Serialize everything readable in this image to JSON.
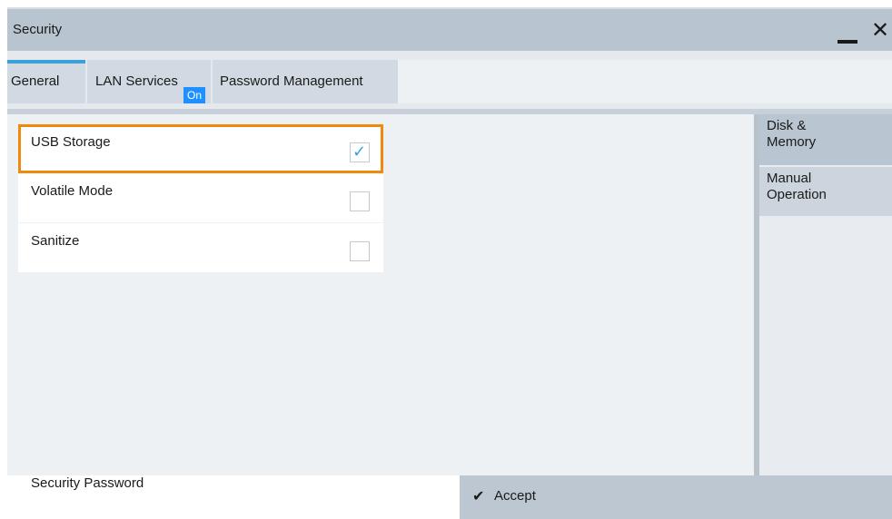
{
  "window": {
    "title": "Security"
  },
  "tabs": [
    {
      "label": "General",
      "active": true
    },
    {
      "label": "LAN Services",
      "badge": "On"
    },
    {
      "label": "Password Management"
    }
  ],
  "settings": [
    {
      "label": "USB Storage",
      "checked": true
    },
    {
      "label": "Volatile Mode",
      "checked": false
    },
    {
      "label": "Sanitize",
      "checked": false
    }
  ],
  "side_panel": {
    "items": [
      {
        "label_line1": "Disk &",
        "label_line2": "Memory"
      },
      {
        "label_line1": "Manual",
        "label_line2": "Operation"
      }
    ]
  },
  "bottom": {
    "password_label": "Security Password",
    "accept_label": "Accept"
  },
  "icons": {
    "minimize": "minimize-icon",
    "close": "close-icon",
    "checkmark": "checkmark-icon"
  },
  "colors": {
    "accent": "#3aa0dc",
    "focus": "#f0890e",
    "badge": "#1e90ff"
  }
}
